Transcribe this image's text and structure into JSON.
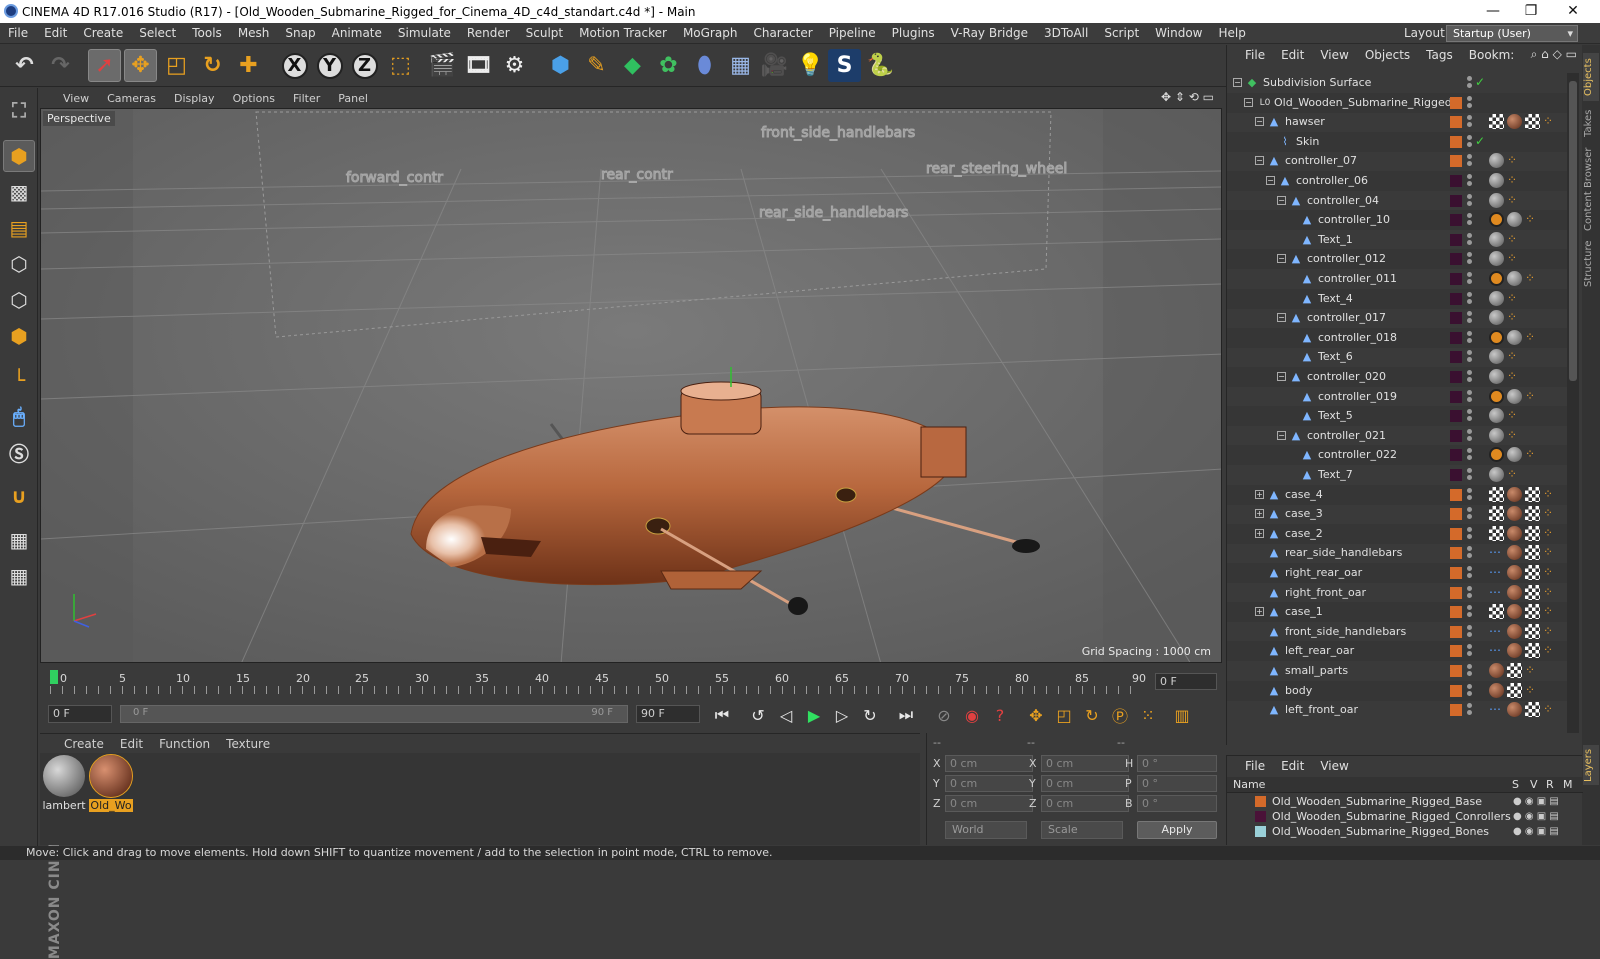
{
  "window": {
    "title": "CINEMA 4D R17.016 Studio (R17) - [Old_Wooden_Submarine_Rigged_for_Cinema_4D_c4d_standart.c4d *] - Main",
    "minimize": "—",
    "maximize": "❐",
    "close": "✕"
  },
  "menubar": {
    "items": [
      "File",
      "Edit",
      "Create",
      "Select",
      "Tools",
      "Mesh",
      "Snap",
      "Animate",
      "Simulate",
      "Render",
      "Sculpt",
      "Motion Tracker",
      "MoGraph",
      "Character",
      "Pipeline",
      "Plugins",
      "V-Ray Bridge",
      "3DToAll",
      "Script",
      "Window",
      "Help"
    ],
    "layout_label": "Layout:",
    "layout_value": "Startup (User)"
  },
  "toolbar": {
    "x_label": "X",
    "y_label": "Y",
    "z_label": "Z"
  },
  "viewport": {
    "menu": [
      "View",
      "Cameras",
      "Display",
      "Options",
      "Filter",
      "Panel"
    ],
    "camera_label": "Perspective",
    "grid_spacing": "Grid Spacing : 1000 cm",
    "scene_labels": [
      "forward_contr",
      "front_side_handlebars",
      "rear_contr",
      "rear_side_handlebars",
      "rear_steering_wheel"
    ]
  },
  "timeline": {
    "ticks": [
      "0",
      "5",
      "10",
      "15",
      "20",
      "25",
      "30",
      "35",
      "40",
      "45",
      "50",
      "55",
      "60",
      "65",
      "70",
      "75",
      "80",
      "85",
      "90"
    ],
    "current_frame": "0 F"
  },
  "transport": {
    "start_field": "0 F",
    "range_start": "0 F",
    "range_end": "90 F",
    "end_field": "90 F"
  },
  "material_manager": {
    "menu": [
      "Create",
      "Edit",
      "Function",
      "Texture"
    ],
    "materials": [
      {
        "name": "lambert",
        "selected": false
      },
      {
        "name": "Old_Wo",
        "selected": true
      }
    ]
  },
  "coordinates": {
    "headers": [
      "--",
      "--",
      "--"
    ],
    "rows": [
      {
        "a_label": "X",
        "a_val": "0 cm",
        "b_label": "X",
        "b_val": "0 cm",
        "c_label": "H",
        "c_val": "0 °"
      },
      {
        "a_label": "Y",
        "a_val": "0 cm",
        "b_label": "Y",
        "b_val": "0 cm",
        "c_label": "P",
        "c_val": "0 °"
      },
      {
        "a_label": "Z",
        "a_val": "0 cm",
        "b_label": "Z",
        "b_val": "0 cm",
        "c_label": "B",
        "c_val": "0 °"
      }
    ],
    "space": "World",
    "mode": "Scale",
    "apply": "Apply"
  },
  "object_manager": {
    "menu": [
      "File",
      "Edit",
      "View",
      "Objects",
      "Tags",
      "Bookm:"
    ],
    "objects": [
      {
        "name": "Subdivision Surface",
        "depth": 0,
        "tree": "-",
        "icon": "subdiv",
        "layer": "",
        "tags": ""
      },
      {
        "name": "Old_Wooden_Submarine_Rigged",
        "depth": 1,
        "tree": "-",
        "icon": "null",
        "layer": "#d46a2a",
        "tags": ""
      },
      {
        "name": "hawser",
        "depth": 2,
        "tree": "-",
        "icon": "joint",
        "layer": "#d46a2a",
        "tags": "check-wood-check-joint"
      },
      {
        "name": "Skin",
        "depth": 3,
        "tree": "",
        "icon": "skin",
        "layer": "#d46a2a",
        "tags": ""
      },
      {
        "name": "controller_07",
        "depth": 2,
        "tree": "-",
        "icon": "joint",
        "layer": "#d46a2a",
        "tags": "grey-joint"
      },
      {
        "name": "controller_06",
        "depth": 3,
        "tree": "-",
        "icon": "joint",
        "layer": "#3a1030",
        "tags": "grey-joint"
      },
      {
        "name": "controller_04",
        "depth": 4,
        "tree": "-",
        "icon": "joint",
        "layer": "#3a1030",
        "tags": "grey-joint"
      },
      {
        "name": "controller_10",
        "depth": 5,
        "tree": "",
        "icon": "joint",
        "layer": "#3a1030",
        "tags": "no-grey-joint"
      },
      {
        "name": "Text_1",
        "depth": 5,
        "tree": "",
        "icon": "joint",
        "layer": "#3a1030",
        "tags": "grey-joint"
      },
      {
        "name": "controller_012",
        "depth": 4,
        "tree": "-",
        "icon": "joint",
        "layer": "#3a1030",
        "tags": "grey-joint"
      },
      {
        "name": "controller_011",
        "depth": 5,
        "tree": "",
        "icon": "joint",
        "layer": "#3a1030",
        "tags": "no-grey-joint"
      },
      {
        "name": "Text_4",
        "depth": 5,
        "tree": "",
        "icon": "joint",
        "layer": "#3a1030",
        "tags": "grey-joint"
      },
      {
        "name": "controller_017",
        "depth": 4,
        "tree": "-",
        "icon": "joint",
        "layer": "#3a1030",
        "tags": "grey-joint"
      },
      {
        "name": "controller_018",
        "depth": 5,
        "tree": "",
        "icon": "joint",
        "layer": "#3a1030",
        "tags": "no-grey-joint"
      },
      {
        "name": "Text_6",
        "depth": 5,
        "tree": "",
        "icon": "joint",
        "layer": "#3a1030",
        "tags": "grey-joint"
      },
      {
        "name": "controller_020",
        "depth": 4,
        "tree": "-",
        "icon": "joint",
        "layer": "#3a1030",
        "tags": "grey-joint"
      },
      {
        "name": "controller_019",
        "depth": 5,
        "tree": "",
        "icon": "joint",
        "layer": "#3a1030",
        "tags": "no-grey-joint"
      },
      {
        "name": "Text_5",
        "depth": 5,
        "tree": "",
        "icon": "joint",
        "layer": "#3a1030",
        "tags": "grey-joint"
      },
      {
        "name": "controller_021",
        "depth": 4,
        "tree": "-",
        "icon": "joint",
        "layer": "#3a1030",
        "tags": "grey-joint"
      },
      {
        "name": "controller_022",
        "depth": 5,
        "tree": "",
        "icon": "joint",
        "layer": "#3a1030",
        "tags": "no-grey-joint"
      },
      {
        "name": "Text_7",
        "depth": 5,
        "tree": "",
        "icon": "joint",
        "layer": "#3a1030",
        "tags": "grey-joint"
      },
      {
        "name": "case_4",
        "depth": 2,
        "tree": "+",
        "icon": "joint",
        "layer": "#d46a2a",
        "tags": "check-wood-check-joint"
      },
      {
        "name": "case_3",
        "depth": 2,
        "tree": "+",
        "icon": "joint",
        "layer": "#d46a2a",
        "tags": "check-wood-check-joint"
      },
      {
        "name": "case_2",
        "depth": 2,
        "tree": "+",
        "icon": "joint",
        "layer": "#d46a2a",
        "tags": "check-wood-check-joint"
      },
      {
        "name": "rear_side_handlebars",
        "depth": 2,
        "tree": "",
        "icon": "joint",
        "layer": "#d46a2a",
        "tags": "dots-wood-check-joint"
      },
      {
        "name": "right_rear_oar",
        "depth": 2,
        "tree": "",
        "icon": "joint",
        "layer": "#d46a2a",
        "tags": "dots-wood-check-joint"
      },
      {
        "name": "right_front_oar",
        "depth": 2,
        "tree": "",
        "icon": "joint",
        "layer": "#d46a2a",
        "tags": "dots-wood-check-joint"
      },
      {
        "name": "case_1",
        "depth": 2,
        "tree": "+",
        "icon": "joint",
        "layer": "#d46a2a",
        "tags": "check-wood-check-joint"
      },
      {
        "name": "front_side_handlebars",
        "depth": 2,
        "tree": "",
        "icon": "joint",
        "layer": "#d46a2a",
        "tags": "dots-wood-check-joint"
      },
      {
        "name": "left_rear_oar",
        "depth": 2,
        "tree": "",
        "icon": "joint",
        "layer": "#d46a2a",
        "tags": "dots-wood-check-joint"
      },
      {
        "name": "small_parts",
        "depth": 2,
        "tree": "",
        "icon": "joint",
        "layer": "#d46a2a",
        "tags": "wood-check-joint"
      },
      {
        "name": "body",
        "depth": 2,
        "tree": "",
        "icon": "joint",
        "layer": "#d46a2a",
        "tags": "wood-check-joint"
      },
      {
        "name": "left_front_oar",
        "depth": 2,
        "tree": "",
        "icon": "joint",
        "layer": "#d46a2a",
        "tags": "dots-wood-check-joint"
      }
    ]
  },
  "right_tabs": [
    "Objects",
    "Takes",
    "Content Browser",
    "Structure",
    "Layers"
  ],
  "layer_manager": {
    "menu": [
      "File",
      "Edit",
      "View"
    ],
    "header": {
      "name": "Name",
      "s": "S",
      "v": "V",
      "r": "R",
      "m": "M"
    },
    "layers": [
      {
        "name": "Old_Wooden_Submarine_Rigged_Base",
        "color": "#d46a2a"
      },
      {
        "name": "Old_Wooden_Submarine_Rigged_Conrollers",
        "color": "#4a1238"
      },
      {
        "name": "Old_Wooden_Submarine_Rigged_Bones",
        "color": "#9ad0d8"
      }
    ]
  },
  "status": "Move: Click and drag to move elements. Hold down SHIFT to quantize movement / add to the selection in point mode, CTRL to remove."
}
